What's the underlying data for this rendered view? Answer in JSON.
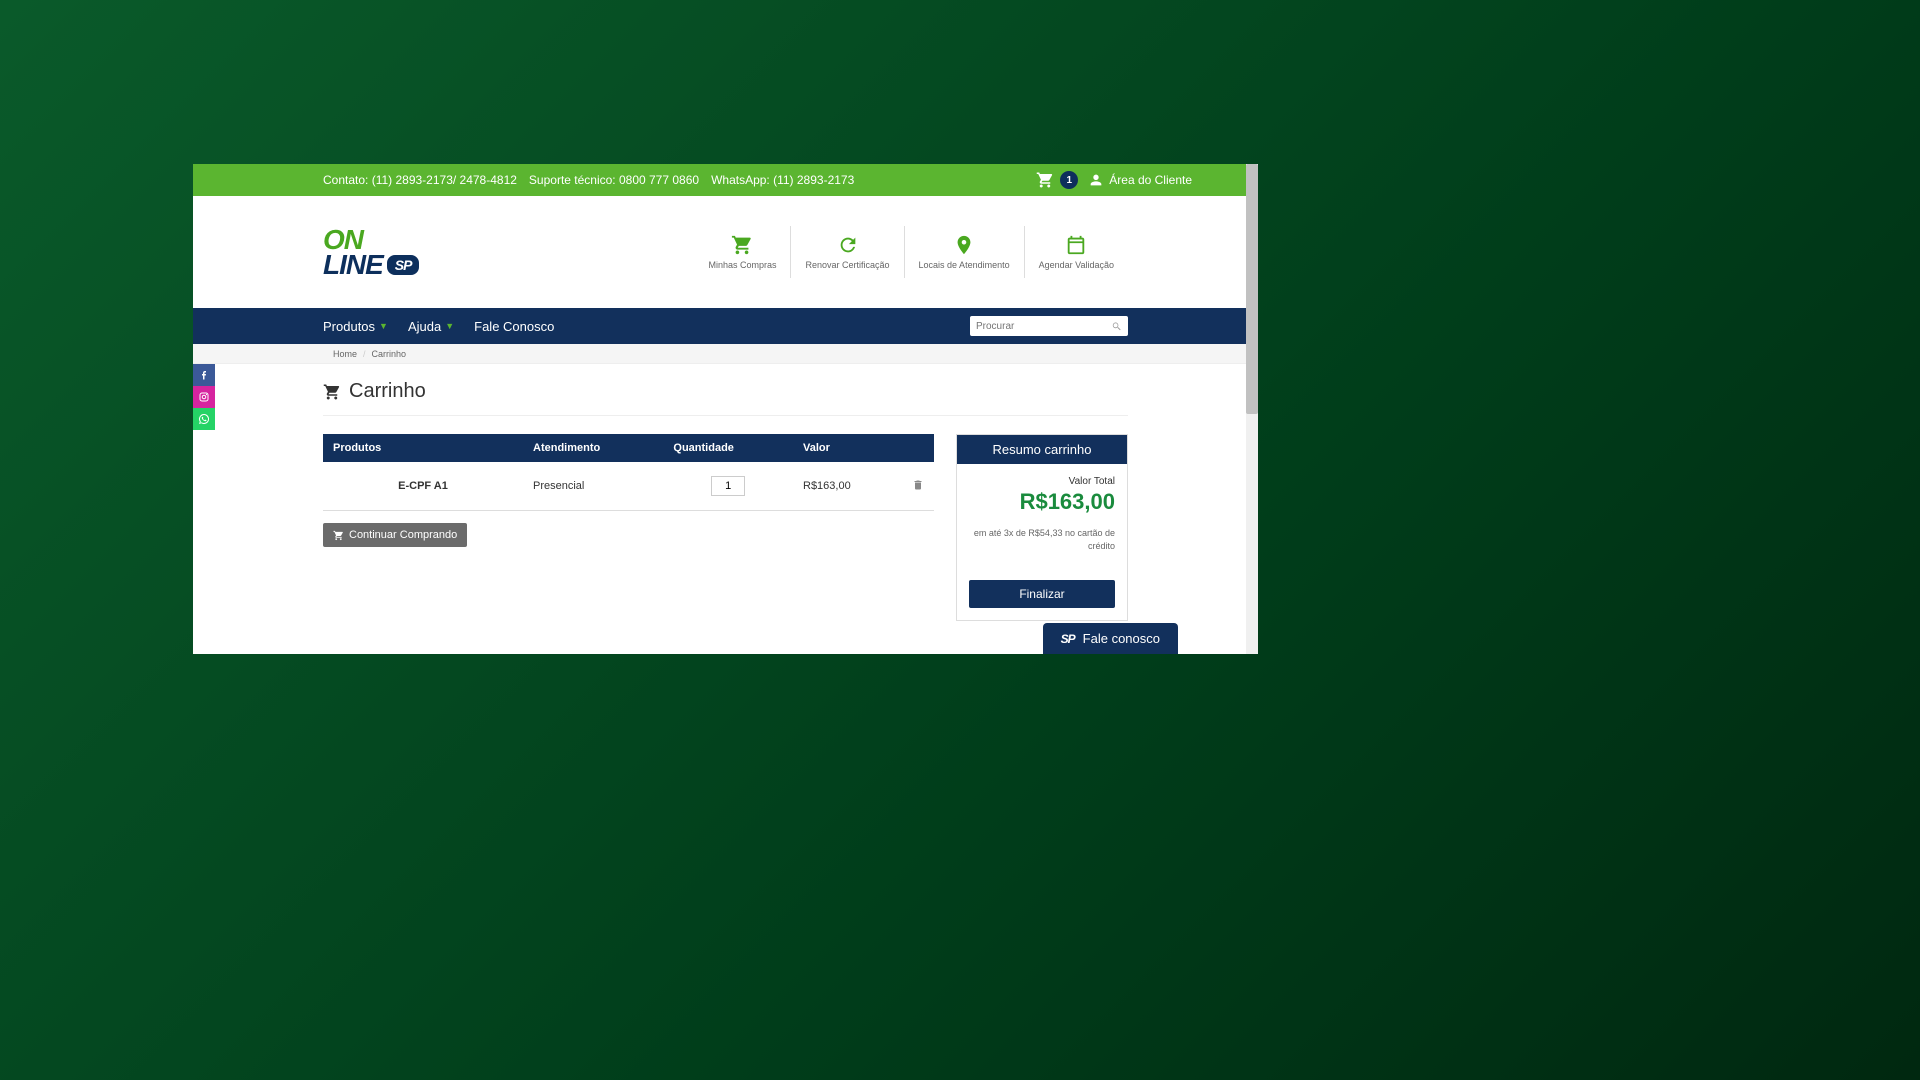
{
  "topbar": {
    "contact": "Contato: (11) 2893-2173/ 2478-4812",
    "support": "Suporte técnico: 0800 777 0860",
    "whatsapp": "WhatsApp: (11) 2893-2173",
    "cart_count": "1",
    "client_area": "Área do Cliente"
  },
  "logo": {
    "on": "ON",
    "line": "LINE",
    "sp": "SP"
  },
  "header_actions": [
    {
      "label": "Minhas Compras"
    },
    {
      "label": "Renovar Certificação"
    },
    {
      "label": "Locais de Atendimento"
    },
    {
      "label": "Agendar Validação"
    }
  ],
  "nav": {
    "items": [
      "Produtos",
      "Ajuda",
      "Fale Conosco"
    ],
    "search_placeholder": "Procurar"
  },
  "breadcrumb": {
    "home": "Home",
    "current": "Carrinho"
  },
  "page_title": "Carrinho",
  "table": {
    "headers": [
      "Produtos",
      "Atendimento",
      "Quantidade",
      "Valor"
    ],
    "rows": [
      {
        "product": "E-CPF A1",
        "service": "Presencial",
        "qty": "1",
        "value": "R$163,00"
      }
    ]
  },
  "continue_label": "Continuar Comprando",
  "summary": {
    "title": "Resumo carrinho",
    "total_label": "Valor Total",
    "total_value": "R$163,00",
    "installment": "em até 3x de R$54,33 no cartão de crédito",
    "finalize": "Finalizar"
  },
  "fale_float": "Fale conosco"
}
